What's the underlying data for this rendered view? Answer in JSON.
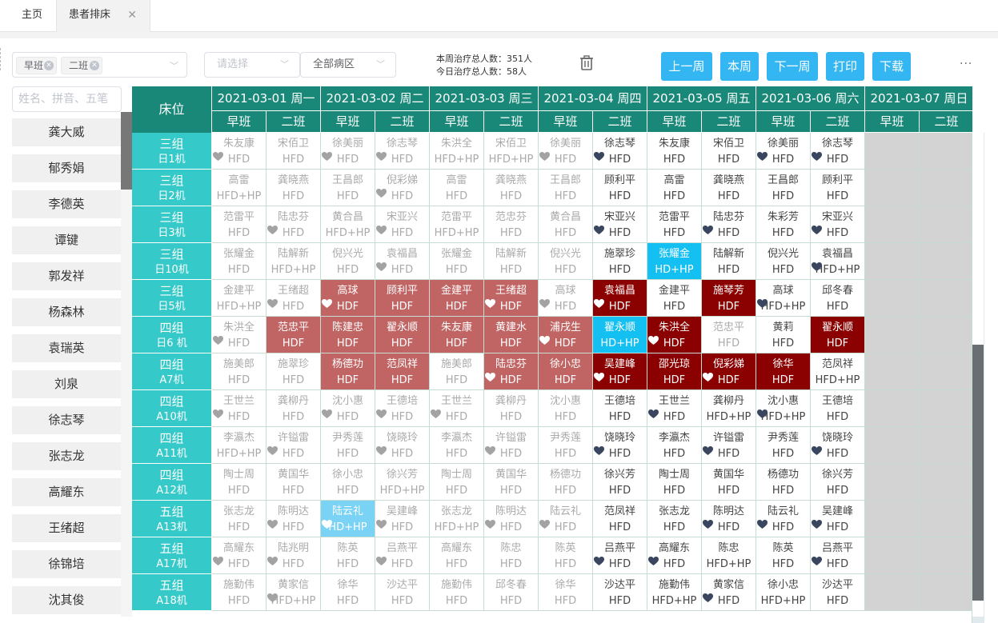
{
  "tabs": [
    {
      "label": "主页"
    },
    {
      "label": "患者排床"
    }
  ],
  "filter": {
    "tags": [
      "早班",
      "二班"
    ],
    "ward_placeholder": "请选择",
    "area": "全部病区"
  },
  "stats": {
    "week": "本周治疗总人数：351人",
    "today": "今日治疗总人数：58人"
  },
  "buttons": {
    "prev_week": "上一周",
    "this_week": "本周",
    "next_week": "下一周",
    "print": "打印",
    "download": "下载"
  },
  "more": "···",
  "search_placeholder": "姓名、拼音、五笔",
  "patients": [
    "龚大威",
    "郁秀娟",
    "李德英",
    "谭键",
    "郭发祥",
    "杨森林",
    "袁瑞英",
    "刘泉",
    "徐志琴",
    "张志龙",
    "高耀东",
    "王绪超",
    "徐锦培",
    "沈其俊"
  ],
  "grid": {
    "corner": "床位",
    "days": [
      "2021-03-01 周一",
      "2021-03-02 周二",
      "2021-03-03 周三",
      "2021-03-04 周四",
      "2021-03-05 周五",
      "2021-03-06 周六",
      "2021-03-07 周日"
    ],
    "shifts": [
      "早班",
      "二班"
    ],
    "colors": {
      "header": "#1a8878",
      "bed": "#35c9c9",
      "dim": "#aaa",
      "active": "#444",
      "dark_red": "#8b0000",
      "rose": "#c16464",
      "blue": "#14bff2",
      "light_blue": "#7ad2f5",
      "grey": "#d3d3d3"
    },
    "rows": [
      {
        "group": "三组",
        "machine": "日1机",
        "cells": [
          [
            "朱友康",
            "HFD",
            "dim",
            "grey"
          ],
          [
            "宋佰卫",
            "HFD",
            "dim",
            ""
          ],
          [
            "徐美丽",
            "HFD",
            "dim",
            "grey"
          ],
          [
            "徐志琴",
            "HFD",
            "dim",
            "grey"
          ],
          [
            "朱洪全",
            "HFD+HP",
            "dim",
            ""
          ],
          [
            "宋佰卫",
            "HFD+HP",
            "dim",
            ""
          ],
          [
            "徐美丽",
            "HFD",
            "dim",
            "grey"
          ],
          [
            "徐志琴",
            "HFD",
            "act",
            "dark"
          ],
          [
            "朱友康",
            "HFD",
            "act",
            ""
          ],
          [
            "宋佰卫",
            "HFD",
            "act",
            ""
          ],
          [
            "徐美丽",
            "HFD",
            "act",
            "dark"
          ],
          [
            "徐志琴",
            "HFD",
            "act",
            "dark"
          ]
        ]
      },
      {
        "group": "三组",
        "machine": "日2机",
        "cells": [
          [
            "高雷",
            "HFD+HP",
            "dim",
            ""
          ],
          [
            "龚晓燕",
            "HFD",
            "dim",
            ""
          ],
          [
            "王昌郎",
            "HFD",
            "dim",
            ""
          ],
          [
            "倪彩娣",
            "HFD",
            "dim",
            "grey"
          ],
          [
            "高雷",
            "HFD",
            "dim",
            ""
          ],
          [
            "龚晓燕",
            "HFD",
            "dim",
            ""
          ],
          [
            "王昌郎",
            "HFD",
            "dim",
            ""
          ],
          [
            "顾利平",
            "HFD",
            "act",
            ""
          ],
          [
            "高雷",
            "HFD",
            "act",
            ""
          ],
          [
            "龚晓燕",
            "HFD",
            "act",
            ""
          ],
          [
            "王昌郎",
            "HFD",
            "act",
            ""
          ],
          [
            "顾利平",
            "HFD",
            "act",
            ""
          ]
        ]
      },
      {
        "group": "三组",
        "machine": "日3机",
        "cells": [
          [
            "范雷平",
            "HFD",
            "dim",
            ""
          ],
          [
            "陆忠芬",
            "HFD",
            "dim",
            "grey"
          ],
          [
            "黄合昌",
            "HFD+HP",
            "dim",
            ""
          ],
          [
            "宋亚兴",
            "HFD",
            "dim",
            "grey"
          ],
          [
            "范雷平",
            "HFD+HP",
            "dim",
            ""
          ],
          [
            "范忠芬",
            "HFD",
            "dim",
            ""
          ],
          [
            "黄合昌",
            "HFD",
            "dim",
            ""
          ],
          [
            "宋亚兴",
            "HFD",
            "act",
            "dark"
          ],
          [
            "范雷平",
            "HFD",
            "act",
            ""
          ],
          [
            "陆忠芬",
            "HFD",
            "act",
            "dark"
          ],
          [
            "朱彩芳",
            "HFD",
            "act",
            ""
          ],
          [
            "宋亚兴",
            "HFD",
            "act",
            "dark"
          ]
        ]
      },
      {
        "group": "三组",
        "machine": "日10机",
        "cells": [
          [
            "张耀金",
            "HFD",
            "dim",
            ""
          ],
          [
            "陆解新",
            "HFD+HP",
            "dim",
            ""
          ],
          [
            "倪兴光",
            "HFD",
            "dim",
            ""
          ],
          [
            "袁福昌",
            "HFD",
            "dim",
            "grey"
          ],
          [
            "张耀金",
            "HFD",
            "dim",
            ""
          ],
          [
            "陆解新",
            "HFD",
            "dim",
            ""
          ],
          [
            "倪兴光",
            "HFD",
            "dim",
            ""
          ],
          [
            "施翠珍",
            "HFD",
            "act",
            ""
          ],
          [
            "张耀金",
            "HD+HP",
            "blue",
            ""
          ],
          [
            "陆解新",
            "HFD",
            "act",
            ""
          ],
          [
            "倪兴光",
            "HFD",
            "act",
            ""
          ],
          [
            "袁福昌",
            "HFD+HP",
            "act",
            "dark"
          ]
        ]
      },
      {
        "group": "三组",
        "machine": "日5机",
        "cells": [
          [
            "金建平",
            "HFD+HP",
            "dim",
            ""
          ],
          [
            "王绪超",
            "HFD",
            "dim",
            "grey"
          ],
          [
            "高球",
            "HDF",
            "rose",
            "white"
          ],
          [
            "顾利平",
            "HDF",
            "rose",
            ""
          ],
          [
            "金建平",
            "HDF",
            "rose",
            ""
          ],
          [
            "王绪超",
            "HDF",
            "rose",
            "white"
          ],
          [
            "高球",
            "HFD",
            "dim",
            "grey"
          ],
          [
            "袁福昌",
            "HDF",
            "dark",
            "white"
          ],
          [
            "金建平",
            "HFD",
            "act",
            ""
          ],
          [
            "施琴芳",
            "HDF",
            "dark",
            ""
          ],
          [
            "高球",
            "HFD+HP",
            "act",
            "dark"
          ],
          [
            "邱冬春",
            "HFD",
            "act",
            ""
          ]
        ]
      },
      {
        "group": "四组",
        "machine": "日6 机",
        "cells": [
          [
            "朱洪全",
            "HFD",
            "dim",
            "grey"
          ],
          [
            "范忠平",
            "HDF",
            "rose",
            ""
          ],
          [
            "陈建忠",
            "HDF",
            "rose",
            ""
          ],
          [
            "翟永顺",
            "HDF",
            "rose",
            ""
          ],
          [
            "朱友康",
            "HDF",
            "rose",
            ""
          ],
          [
            "黄建水",
            "HDF",
            "rose",
            ""
          ],
          [
            "浦戌生",
            "HDF",
            "rose",
            "white"
          ],
          [
            "翟永顺",
            "HD+HP",
            "blue",
            ""
          ],
          [
            "朱洪全",
            "HDF",
            "dark",
            "white"
          ],
          [
            "范忠平",
            "HFD",
            "dim",
            ""
          ],
          [
            "黄莉",
            "HFD",
            "act",
            ""
          ],
          [
            "翟永顺",
            "HDF",
            "dark",
            ""
          ]
        ]
      },
      {
        "group": "四组",
        "machine": "A7机",
        "cells": [
          [
            "施美郎",
            "HFD",
            "dim",
            ""
          ],
          [
            "施翠珍",
            "HFD",
            "dim",
            ""
          ],
          [
            "杨德功",
            "HDF",
            "rose",
            ""
          ],
          [
            "范凤祥",
            "HDF",
            "rose",
            ""
          ],
          [
            "施美郎",
            "HFD",
            "dim",
            ""
          ],
          [
            "陆忠芬",
            "HDF",
            "rose",
            "white"
          ],
          [
            "徐小忠",
            "HDF",
            "rose",
            ""
          ],
          [
            "吴建峰",
            "HDF",
            "dark",
            "white"
          ],
          [
            "邵光琼",
            "HDF",
            "dark",
            ""
          ],
          [
            "倪彩娣",
            "HDF",
            "dark",
            "white"
          ],
          [
            "徐华",
            "HDF",
            "dark",
            ""
          ],
          [
            "范凤祥",
            "HFD+HP",
            "act",
            ""
          ]
        ]
      },
      {
        "group": "四组",
        "machine": "A10机",
        "cells": [
          [
            "王世兰",
            "HFD",
            "dim",
            "grey"
          ],
          [
            "龚柳丹",
            "HFD",
            "dim",
            ""
          ],
          [
            "沈小惠",
            "HFD",
            "dim",
            "grey"
          ],
          [
            "王德培",
            "HFD",
            "dim",
            "grey"
          ],
          [
            "王世兰",
            "HFD",
            "dim",
            "grey"
          ],
          [
            "龚柳丹",
            "HFD",
            "dim",
            ""
          ],
          [
            "沈小惠",
            "HFD",
            "dim",
            ""
          ],
          [
            "王德培",
            "HFD",
            "act",
            ""
          ],
          [
            "王世兰",
            "HFD",
            "act",
            "dark"
          ],
          [
            "龚柳丹",
            "HFD+HP",
            "act",
            ""
          ],
          [
            "沈小惠",
            "HFD+HP",
            "act",
            "dark"
          ],
          [
            "王德培",
            "HFD",
            "act",
            ""
          ]
        ]
      },
      {
        "group": "四组",
        "machine": "A11机",
        "cells": [
          [
            "李瀛杰",
            "HFD+HP",
            "dim",
            ""
          ],
          [
            "许镒雷",
            "HFD",
            "dim",
            "grey"
          ],
          [
            "尹秀莲",
            "HFD",
            "dim",
            ""
          ],
          [
            "饶晓玲",
            "HFD",
            "dim",
            "grey"
          ],
          [
            "李瀛杰",
            "HFD",
            "dim",
            ""
          ],
          [
            "许镒雷",
            "HFD",
            "dim",
            "grey"
          ],
          [
            "尹秀莲",
            "HFD",
            "dim",
            ""
          ],
          [
            "饶晓玲",
            "HFD",
            "act",
            "dark"
          ],
          [
            "李瀛杰",
            "HFD",
            "act",
            ""
          ],
          [
            "许镒雷",
            "HFD",
            "act",
            "dark"
          ],
          [
            "尹秀莲",
            "HFD",
            "act",
            ""
          ],
          [
            "饶晓玲",
            "HFD",
            "act",
            "dark"
          ]
        ]
      },
      {
        "group": "四组",
        "machine": "A12机",
        "cells": [
          [
            "陶士周",
            "HFD",
            "dim",
            ""
          ],
          [
            "黄国华",
            "HFD",
            "dim",
            ""
          ],
          [
            "徐小忠",
            "HFD",
            "dim",
            ""
          ],
          [
            "徐兴芳",
            "HFD+HP",
            "dim",
            ""
          ],
          [
            "陶士周",
            "HFD",
            "dim",
            ""
          ],
          [
            "黄国华",
            "HFD",
            "dim",
            ""
          ],
          [
            "杨德功",
            "HFD",
            "dim",
            ""
          ],
          [
            "徐兴芳",
            "HFD",
            "act",
            ""
          ],
          [
            "陶士周",
            "HFD",
            "act",
            ""
          ],
          [
            "黄国华",
            "HFD",
            "act",
            ""
          ],
          [
            "杨德功",
            "HFD",
            "act",
            ""
          ],
          [
            "徐兴芳",
            "HFD",
            "act",
            ""
          ]
        ]
      },
      {
        "group": "五组",
        "machine": "A13机",
        "cells": [
          [
            "张志龙",
            "HFD",
            "dim",
            ""
          ],
          [
            "陈明达",
            "HFD",
            "dim",
            "grey"
          ],
          [
            "陆云礼",
            "HD+HP",
            "lblue",
            "white"
          ],
          [
            "吴建峰",
            "HFD",
            "dim",
            "grey"
          ],
          [
            "张志龙",
            "HFD+HP",
            "dim",
            ""
          ],
          [
            "陈明达",
            "HFD",
            "dim",
            "grey"
          ],
          [
            "陆云礼",
            "HFD",
            "dim",
            "grey"
          ],
          [
            "范凤祥",
            "HFD",
            "act",
            ""
          ],
          [
            "张志龙",
            "HFD",
            "act",
            ""
          ],
          [
            "陈明达",
            "HFD",
            "act",
            "dark"
          ],
          [
            "陆云礼",
            "HFD",
            "act",
            "dark"
          ],
          [
            "吴建峰",
            "HFD",
            "act",
            "dark"
          ]
        ]
      },
      {
        "group": "五组",
        "machine": "A17机",
        "cells": [
          [
            "高耀东",
            "HFD",
            "dim",
            "grey"
          ],
          [
            "陆兆明",
            "HFD",
            "dim",
            "grey"
          ],
          [
            "陈英",
            "HFD",
            "dim",
            ""
          ],
          [
            "吕燕平",
            "HFD",
            "dim",
            "grey"
          ],
          [
            "高耀东",
            "HFD",
            "dim",
            ""
          ],
          [
            "陈忠",
            "HFD",
            "dim",
            ""
          ],
          [
            "陈英",
            "HFD",
            "dim",
            ""
          ],
          [
            "吕燕平",
            "HFD",
            "act",
            "dark"
          ],
          [
            "高耀东",
            "HFD",
            "act",
            "dark"
          ],
          [
            "陈忠",
            "HFD+HP",
            "act",
            ""
          ],
          [
            "陈英",
            "HFD",
            "act",
            ""
          ],
          [
            "吕燕平",
            "HFD",
            "act",
            "dark"
          ]
        ]
      },
      {
        "group": "五组",
        "machine": "A18机",
        "cells": [
          [
            "施勤伟",
            "HFD",
            "dim",
            ""
          ],
          [
            "黄家信",
            "HFD+HP",
            "dim",
            "grey"
          ],
          [
            "徐华",
            "HFD",
            "dim",
            ""
          ],
          [
            "沙达平",
            "HFD",
            "dim",
            ""
          ],
          [
            "施勤伟",
            "HFD",
            "dim",
            ""
          ],
          [
            "邱冬春",
            "HFD",
            "dim",
            ""
          ],
          [
            "徐华",
            "HFD",
            "dim",
            ""
          ],
          [
            "沙达平",
            "HFD",
            "act",
            ""
          ],
          [
            "施勤伟",
            "HFD+HP",
            "act",
            ""
          ],
          [
            "黄家信",
            "HFD",
            "act",
            "dark"
          ],
          [
            "徐小忠",
            "HFD+HP",
            "act",
            ""
          ],
          [
            "沙达平",
            "HFD",
            "act",
            ""
          ]
        ]
      }
    ]
  }
}
